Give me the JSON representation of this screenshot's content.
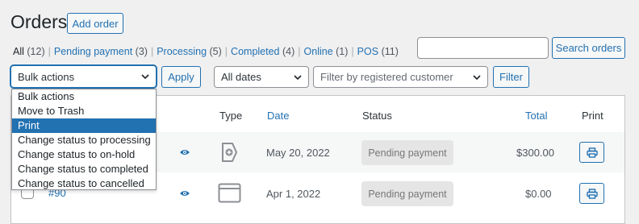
{
  "page": {
    "title": "Orders",
    "add_order_label": "Add order"
  },
  "filters": [
    {
      "label": "All",
      "count": "(12)",
      "current": true
    },
    {
      "label": "Pending payment",
      "count": "(3)"
    },
    {
      "label": "Processing",
      "count": "(5)"
    },
    {
      "label": "Completed",
      "count": "(4)"
    },
    {
      "label": "Online",
      "count": "(1)"
    },
    {
      "label": "POS",
      "count": "(11)"
    }
  ],
  "search": {
    "value": "",
    "button_label": "Search orders"
  },
  "toolbar": {
    "bulk_selected": "Bulk actions",
    "apply_label": "Apply",
    "dates_selected": "All dates",
    "customer_placeholder": "Filter by registered customer",
    "filter_label": "Filter"
  },
  "bulk_menu": [
    "Bulk actions",
    "Move to Trash",
    "Print",
    "Change status to processing",
    "Change status to on-hold",
    "Change status to completed",
    "Change status to cancelled"
  ],
  "bulk_menu_highlighted": "Print",
  "table": {
    "headers": {
      "type": "Type",
      "date": "Date",
      "status": "Status",
      "total": "Total",
      "print": "Print"
    },
    "rows": [
      {
        "order": "",
        "date": "May 20, 2022",
        "status": "Pending payment",
        "total": "$300.00",
        "type_icon": "tag-icon"
      },
      {
        "order": "#90",
        "date": "Apr 1, 2022",
        "status": "Pending payment",
        "total": "$0.00",
        "type_icon": "browser-window-icon"
      }
    ]
  },
  "colors": {
    "accent": "#2271b1",
    "background": "#f0f0f1",
    "status_pill": "#e5e5e5"
  }
}
